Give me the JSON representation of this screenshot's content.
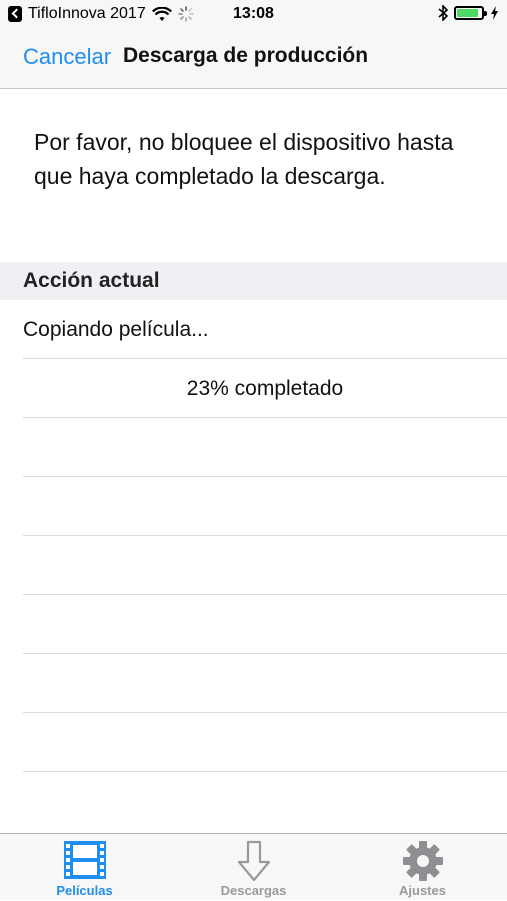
{
  "status_bar": {
    "carrier": "TifloInnova 2017",
    "time": "13:08",
    "battery_level": 0.9
  },
  "nav": {
    "cancel_label": "Cancelar",
    "title": "Descarga de producción"
  },
  "message": "Por favor, no bloquee el dispositivo hasta que haya completado la descarga.",
  "section": {
    "header": "Acción actual",
    "action_text": "Copiando película...",
    "progress_text": "23% completado",
    "progress_value": 0.23
  },
  "tabs": [
    {
      "label": "Películas",
      "icon": "film-icon",
      "active": true
    },
    {
      "label": "Descargas",
      "icon": "download-arrow-icon",
      "active": false
    },
    {
      "label": "Ajustes",
      "icon": "gear-icon",
      "active": false
    }
  ],
  "colors": {
    "accent": "#1f8ef1",
    "inactive": "#9a9a9a",
    "battery": "#4cd964"
  }
}
